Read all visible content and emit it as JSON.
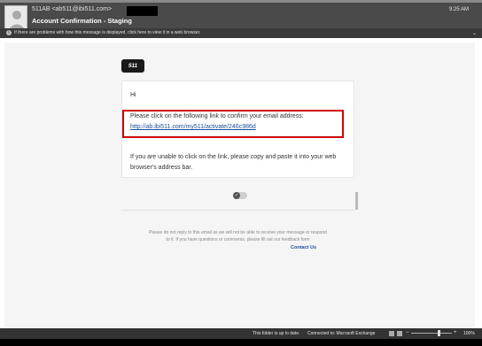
{
  "header": {
    "sender": "511AB <ab511@ibi511.com>",
    "subject": "Account Confirmation - Staging",
    "time": "9:25 AM",
    "info_bar": "If there are problems with how this message is displayed, click here to view it in a web browser."
  },
  "email": {
    "logo_text": "511",
    "greeting": "Hi",
    "message_line1": "Please click on the following link to confirm your email address:",
    "link": "http://ab.ibi511.com/my511/activate/246c986d",
    "message_line2": "If you are unable to click on the link, please copy and paste it into your web browser's address bar.",
    "footer_line1": "Please do not reply to this email as we will not be able to receive your message or respond",
    "footer_line2": "to it. If you have questions or comments, please fill out our feedback form",
    "contact_label": "Contact Us"
  },
  "status": {
    "folder_status": "This folder is up to date.",
    "connection": "Connected to: Microsoft Exchange",
    "zoom": "100%"
  },
  "colors": {
    "header_bg": "#4a4a4a",
    "highlight_border": "#cc0000",
    "link": "#1a4e9c"
  }
}
